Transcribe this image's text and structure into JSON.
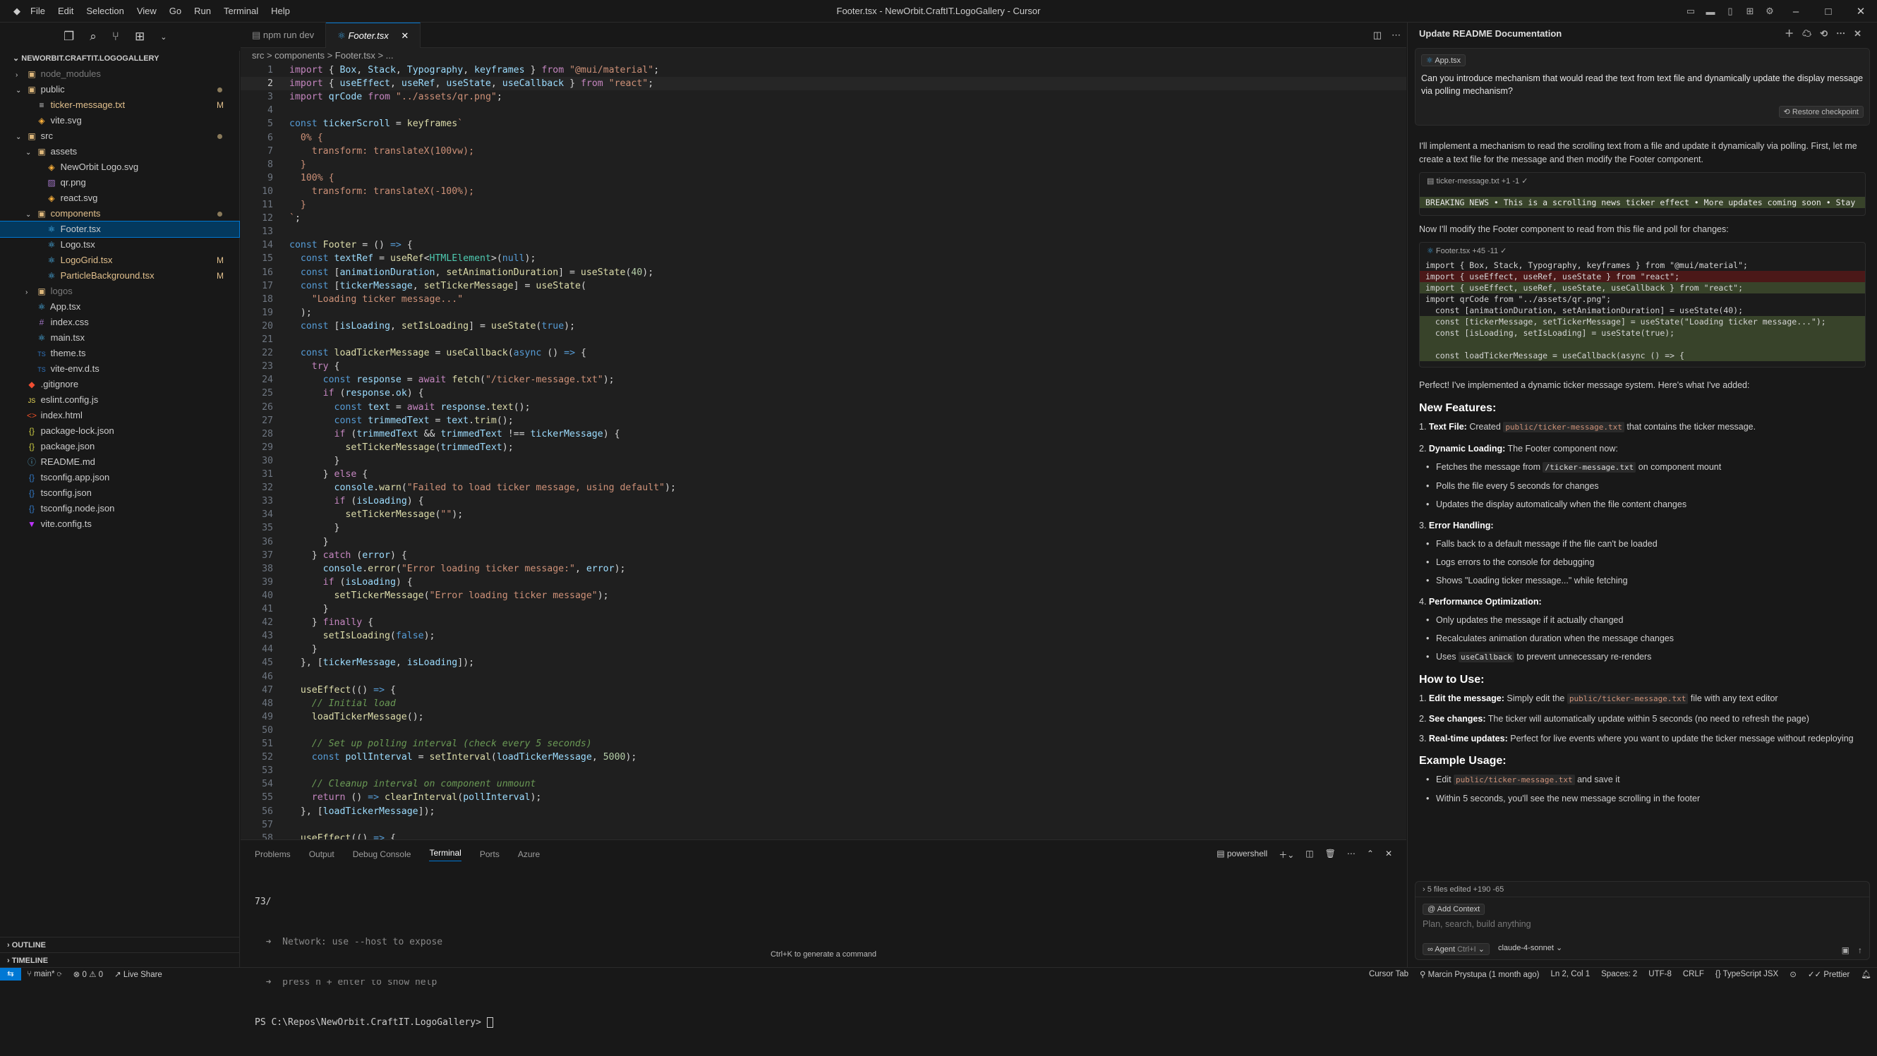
{
  "menu": [
    "File",
    "Edit",
    "Selection",
    "View",
    "Go",
    "Run",
    "Terminal",
    "Help"
  ],
  "window_title": "Footer.tsx - NewOrbit.CraftIT.LogoGallery - Cursor",
  "explorer": {
    "root": "NEWORBIT.CRAFTIT.LOGOGALLERY",
    "rows": [
      {
        "name": "node_modules",
        "depth": 1,
        "type": "folder",
        "open": false,
        "color": "#7a7a7a",
        "badge": ""
      },
      {
        "name": "public",
        "depth": 1,
        "type": "folder",
        "open": true,
        "color": "#cccccc",
        "badge": "dot"
      },
      {
        "name": "ticker-message.txt",
        "depth": 2,
        "type": "txt",
        "color": "#e2c08d",
        "badge": "M"
      },
      {
        "name": "vite.svg",
        "depth": 2,
        "type": "svg",
        "color": "#cccccc",
        "badge": ""
      },
      {
        "name": "src",
        "depth": 1,
        "type": "folder",
        "open": true,
        "color": "#cccccc",
        "badge": "dot"
      },
      {
        "name": "assets",
        "depth": 2,
        "type": "folder",
        "open": true,
        "color": "#cccccc",
        "badge": ""
      },
      {
        "name": "NewOrbit Logo.svg",
        "depth": 3,
        "type": "svg",
        "color": "#cccccc",
        "badge": ""
      },
      {
        "name": "qr.png",
        "depth": 3,
        "type": "png",
        "color": "#cccccc",
        "badge": ""
      },
      {
        "name": "react.svg",
        "depth": 3,
        "type": "svg",
        "color": "#cccccc",
        "badge": ""
      },
      {
        "name": "components",
        "depth": 2,
        "type": "folder",
        "open": true,
        "color": "#e2c08d",
        "badge": "dot"
      },
      {
        "name": "Footer.tsx",
        "depth": 3,
        "type": "tsx",
        "color": "#cccccc",
        "badge": "",
        "selected": true
      },
      {
        "name": "Logo.tsx",
        "depth": 3,
        "type": "tsx",
        "color": "#cccccc",
        "badge": ""
      },
      {
        "name": "LogoGrid.tsx",
        "depth": 3,
        "type": "tsx",
        "color": "#e2c08d",
        "badge": "M"
      },
      {
        "name": "ParticleBackground.tsx",
        "depth": 3,
        "type": "tsx",
        "color": "#e2c08d",
        "badge": "M"
      },
      {
        "name": "logos",
        "depth": 2,
        "type": "folder",
        "open": false,
        "color": "#7a7a7a",
        "badge": ""
      },
      {
        "name": "App.tsx",
        "depth": 2,
        "type": "tsx",
        "color": "#cccccc",
        "badge": ""
      },
      {
        "name": "index.css",
        "depth": 2,
        "type": "css",
        "color": "#cccccc",
        "badge": ""
      },
      {
        "name": "main.tsx",
        "depth": 2,
        "type": "tsx",
        "color": "#cccccc",
        "badge": ""
      },
      {
        "name": "theme.ts",
        "depth": 2,
        "type": "ts",
        "color": "#cccccc",
        "badge": ""
      },
      {
        "name": "vite-env.d.ts",
        "depth": 2,
        "type": "ts",
        "color": "#cccccc",
        "badge": ""
      },
      {
        "name": ".gitignore",
        "depth": 1,
        "type": "git",
        "color": "#cccccc",
        "badge": ""
      },
      {
        "name": "eslint.config.js",
        "depth": 1,
        "type": "js",
        "color": "#cccccc",
        "badge": ""
      },
      {
        "name": "index.html",
        "depth": 1,
        "type": "html",
        "color": "#cccccc",
        "badge": ""
      },
      {
        "name": "package-lock.json",
        "depth": 1,
        "type": "json",
        "color": "#cccccc",
        "badge": ""
      },
      {
        "name": "package.json",
        "depth": 1,
        "type": "json",
        "color": "#cccccc",
        "badge": ""
      },
      {
        "name": "README.md",
        "depth": 1,
        "type": "md",
        "color": "#cccccc",
        "badge": ""
      },
      {
        "name": "tsconfig.app.json",
        "depth": 1,
        "type": "tsjson",
        "color": "#cccccc",
        "badge": ""
      },
      {
        "name": "tsconfig.json",
        "depth": 1,
        "type": "tsjson",
        "color": "#cccccc",
        "badge": ""
      },
      {
        "name": "tsconfig.node.json",
        "depth": 1,
        "type": "tsjson",
        "color": "#cccccc",
        "badge": ""
      },
      {
        "name": "vite.config.ts",
        "depth": 1,
        "type": "vite",
        "color": "#cccccc",
        "badge": ""
      }
    ],
    "outline": "OUTLINE",
    "timeline": "TIMELINE"
  },
  "tabs": [
    {
      "label": "npm run dev",
      "active": false
    },
    {
      "label": "Footer.tsx",
      "active": true
    }
  ],
  "breadcrumb": "src > components > Footer.tsx > ...",
  "code": [
    "<k>import</k> { <v>Box</v>, <v>Stack</v>, <v>Typography</v>, <v>keyframes</v> } <k>from</k> <s>\"@mui/material\"</s>;",
    "<k>import</k> { <v>useEffect</v>, <v>useRef</v>, <v>useState</v>, <v>useCallback</v> } <k>from</k> <s>\"react\"</s>;",
    "<k>import</k> <v>qrCode</v> <k>from</k> <s>\"../assets/qr.png\"</s>;",
    "",
    "<b>const</b> <v>tickerScroll</v> = <f>keyframes</f><s>`</s>",
    "<s>  0% {</s>",
    "<s>    transform: translateX(100vw);</s>",
    "<s>  }</s>",
    "<s>  100% {</s>",
    "<s>    transform: translateX(-100%);</s>",
    "<s>  }</s>",
    "<s>`</s>;",
    "",
    "<b>const</b> <f>Footer</f> = () <b>=></b> {",
    "  <b>const</b> <v>textRef</v> = <f>useRef</f>&lt;<t>HTMLElement</t>&gt;(<b>null</b>);",
    "  <b>const</b> [<v>animationDuration</v>, <f>setAnimationDuration</f>] = <f>useState</f>(<n>40</n>);",
    "  <b>const</b> [<v>tickerMessage</v>, <f>setTickerMessage</f>] = <f>useState</f>(",
    "    <s>\"Loading ticker message...\"</s>",
    "  );",
    "  <b>const</b> [<v>isLoading</v>, <f>setIsLoading</f>] = <f>useState</f>(<b>true</b>);",
    "",
    "  <b>const</b> <f>loadTickerMessage</f> = <f>useCallback</f>(<b>async</b> () <b>=></b> {",
    "    <k>try</k> {",
    "      <b>const</b> <v>response</v> = <k>await</k> <f>fetch</f>(<s>\"/ticker-message.txt\"</s>);",
    "      <k>if</k> (<v>response</v>.<v>ok</v>) {",
    "        <b>const</b> <v>text</v> = <k>await</k> <v>response</v>.<f>text</f>();",
    "        <b>const</b> <v>trimmedText</v> = <v>text</v>.<f>trim</f>();",
    "        <k>if</k> (<v>trimmedText</v> &amp;&amp; <v>trimmedText</v> !== <v>tickerMessage</v>) {",
    "          <f>setTickerMessage</f>(<v>trimmedText</v>);",
    "        }",
    "      } <k>else</k> {",
    "        <v>console</v>.<f>warn</f>(<s>\"Failed to load ticker message, using default\"</s>);",
    "        <k>if</k> (<v>isLoading</v>) {",
    "          <f>setTickerMessage</f>(<s>\"\"</s>);",
    "        }",
    "      }",
    "    } <k>catch</k> (<v>error</v>) {",
    "      <v>console</v>.<f>error</f>(<s>\"Error loading ticker message:\"</s>, <v>error</v>);",
    "      <k>if</k> (<v>isLoading</v>) {",
    "        <f>setTickerMessage</f>(<s>\"Error loading ticker message\"</s>);",
    "      }",
    "    } <k>finally</k> {",
    "      <f>setIsLoading</f>(<b>false</b>);",
    "    }",
    "  }, [<v>tickerMessage</v>, <v>isLoading</v>]);",
    "",
    "  <f>useEffect</f>(() <b>=></b> {",
    "    <c>// Initial load</c>",
    "    <f>loadTickerMessage</f>();",
    "",
    "    <c>// Set up polling interval (check every 5 seconds)</c>",
    "    <b>const</b> <v>pollInterval</v> = <f>setInterval</f>(<v>loadTickerMessage</v>, <n>5000</n>);",
    "",
    "    <c>// Cleanup interval on component unmount</c>",
    "    <k>return</k> () <b>=></b> <f>clearInterval</f>(<v>pollInterval</v>);",
    "  }, [<v>loadTickerMessage</v>]);",
    "",
    "  <f>useEffect</f>(() <b>=></b> {"
  ],
  "current_line": 2,
  "panel": {
    "tabs": [
      "Problems",
      "Output",
      "Debug Console",
      "Terminal",
      "Ports",
      "Azure"
    ],
    "active_tab": "Terminal",
    "shell": "powershell",
    "lines": [
      "73/",
      "  ➜  Network: use --host to expose",
      "  ➜  press h + enter to show help",
      "PS C:\\Repos\\NewOrbit.CraftIT.LogoGallery> "
    ],
    "hint": "Ctrl+K to generate a command"
  },
  "chat": {
    "title": "Update README Documentation",
    "user_chip": "App.tsx",
    "user_message": "Can you introduce mechanism that would read the text from text file and dynamically update the display message via polling mechanism?",
    "restore": "Restore checkpoint",
    "msg1": "I'll implement a mechanism to read the scrolling text from a file and update it dynamically via polling. First, let me create a text file for the message and then modify the Footer component.",
    "card1_head": "ticker-message.txt +1 -1 ✓",
    "card1_line": "BREAKING NEWS • This is a scrolling news ticker effect • More updates coming soon • Stay",
    "msg2": "Now I'll modify the Footer component to read from this file and poll for changes:",
    "card2_head": "Footer.tsx +45 -11 ✓",
    "card2_lines": [
      {
        "kind": "",
        "text": "import { Box, Stack, Typography, keyframes } from \"@mui/material\";"
      },
      {
        "kind": "del",
        "text": "import { useEffect, useRef, useState } from \"react\";"
      },
      {
        "kind": "add",
        "text": "import { useEffect, useRef, useState, useCallback } from \"react\";"
      },
      {
        "kind": "",
        "text": "import qrCode from \"../assets/qr.png\";"
      },
      {
        "kind": "",
        "text": "  const [animationDuration, setAnimationDuration] = useState(40);"
      },
      {
        "kind": "add",
        "text": "  const [tickerMessage, setTickerMessage] = useState(\"Loading ticker message...\");"
      },
      {
        "kind": "add",
        "text": "  const [isLoading, setIsLoading] = useState(true);"
      },
      {
        "kind": "add",
        "text": ""
      },
      {
        "kind": "add",
        "text": "  const loadTickerMessage = useCallback(async () => {"
      }
    ],
    "msg3": "Perfect! I've implemented a dynamic ticker message system. Here's what I've added:",
    "h_features": "New Features:",
    "f1_title": "Text File:",
    "f1_a": "Created",
    "f1_code": "public/ticker-message.txt",
    "f1_b": "that contains the ticker message.",
    "f2_title": "Dynamic Loading:",
    "f2_text": "The Footer component now:",
    "f2_s1a": "Fetches the message from",
    "f2_s1code": "/ticker-message.txt",
    "f2_s1b": "on component mount",
    "f2_s2": "Polls the file every 5 seconds for changes",
    "f2_s3": "Updates the display automatically when the file content changes",
    "f3_title": "Error Handling:",
    "f3_s1": "Falls back to a default message if the file can't be loaded",
    "f3_s2": "Logs errors to the console for debugging",
    "f3_s3": "Shows \"Loading ticker message...\" while fetching",
    "f4_title": "Performance Optimization:",
    "f4_s1": "Only updates the message if it actually changed",
    "f4_s2": "Recalculates animation duration when the message changes",
    "f4_s3a": "Uses",
    "f4_s3code": "useCallback",
    "f4_s3b": "to prevent unnecessary re-renders",
    "h_howto": "How to Use:",
    "u1_title": "Edit the message:",
    "u1_a": "Simply edit the",
    "u1_code": "public/ticker-message.txt",
    "u1_b": "file with any text editor",
    "u2_title": "See changes:",
    "u2_text": "The ticker will automatically update within 5 seconds (no need to refresh the page)",
    "u3_title": "Real-time updates:",
    "u3_text": "Perfect for live events where you want to update the ticker message without redeploying",
    "h_example": "Example Usage:",
    "e1a": "Edit",
    "e1code": "public/ticker-message.txt",
    "e1b": "and save it",
    "e2": "Within 5 seconds, you'll see the new message scrolling in the footer",
    "files_edited": "5 files edited +190 -65",
    "add_context": "Add Context",
    "input_placeholder": "Plan, search, build anything",
    "agent_label": "Agent",
    "agent_shortcut": "Ctrl+I",
    "model": "claude-4-sonnet"
  },
  "status": {
    "branch": "main*",
    "errors": "0",
    "warnings": "0",
    "live_share": "Live Share",
    "cursor_tab": "Cursor Tab",
    "blame": "Marcin Prystupa (1 month ago)",
    "position": "Ln 2, Col 1",
    "spaces": "Spaces: 2",
    "encoding": "UTF-8",
    "eol": "CRLF",
    "language": "TypeScript JSX",
    "prettier": "Prettier"
  },
  "colors": {
    "accent": "#0078d4",
    "modified": "#e2c08d",
    "bg": "#181818",
    "editor_bg": "#1f1f1f"
  }
}
